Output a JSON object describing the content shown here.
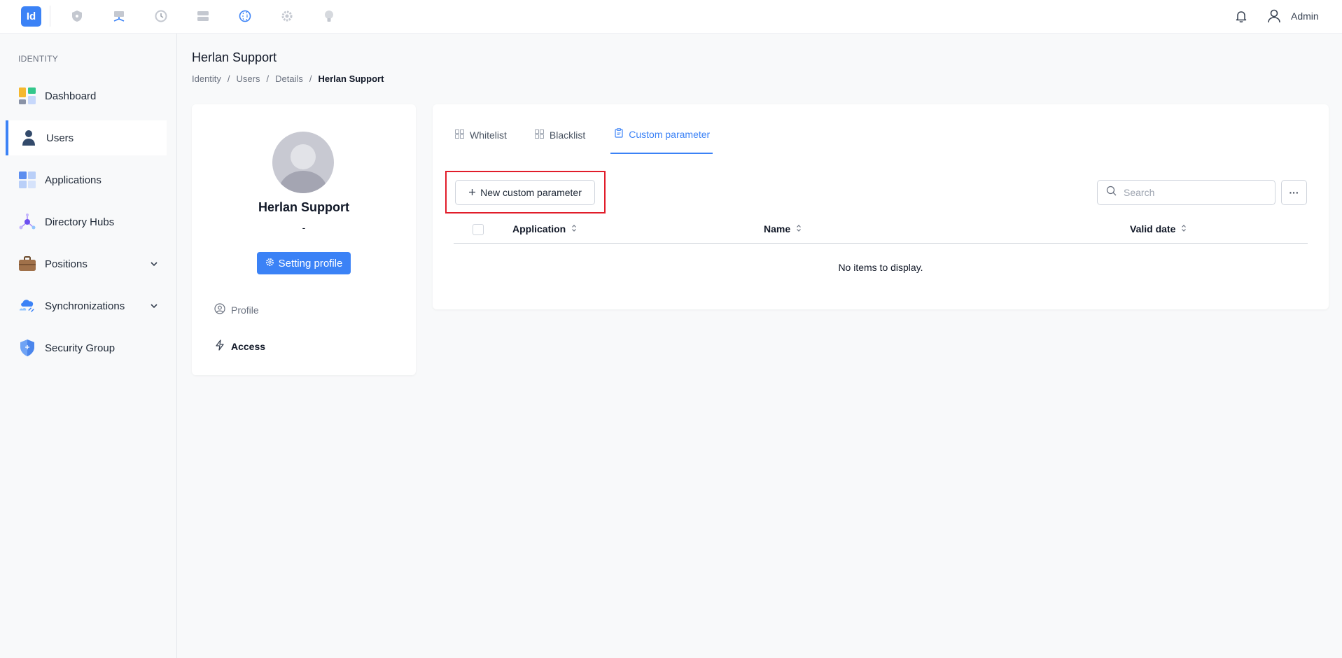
{
  "topbar": {
    "logo_text": "Id",
    "apps": [
      "shield-app-icon",
      "network-app-icon",
      "clock-app-icon",
      "server-app-icon",
      "globe-app-icon",
      "gear-app-icon",
      "bulb-app-icon"
    ],
    "user_label": "Admin"
  },
  "sidebar": {
    "section_title": "IDENTITY",
    "items": [
      {
        "label": "Dashboard",
        "icon": "dashboard-icon"
      },
      {
        "label": "Users",
        "icon": "user-icon",
        "active": true
      },
      {
        "label": "Applications",
        "icon": "applications-icon"
      },
      {
        "label": "Directory Hubs",
        "icon": "hub-icon"
      },
      {
        "label": "Positions",
        "icon": "briefcase-icon",
        "expandable": true
      },
      {
        "label": "Synchronizations",
        "icon": "cloud-sync-icon",
        "expandable": true
      },
      {
        "label": "Security Group",
        "icon": "shield-icon"
      }
    ]
  },
  "header": {
    "title": "Herlan Support",
    "breadcrumb": [
      "Identity",
      "Users",
      "Details",
      "Herlan Support"
    ]
  },
  "profile": {
    "name": "Herlan Support",
    "subtitle": "-",
    "setting_button": "Setting profile",
    "menu": [
      "Profile",
      "Access"
    ]
  },
  "main": {
    "tabs": [
      {
        "label": "Whitelist",
        "active": false
      },
      {
        "label": "Blacklist",
        "active": false
      },
      {
        "label": "Custom parameter",
        "active": true
      }
    ],
    "new_button": "New custom parameter",
    "search_placeholder": "Search",
    "more_button": "···",
    "columns": [
      "Application",
      "Name",
      "Valid date"
    ],
    "empty_text": "No items to display."
  },
  "colors": {
    "accent": "#3b82f6",
    "highlight": "#e11d2a"
  }
}
